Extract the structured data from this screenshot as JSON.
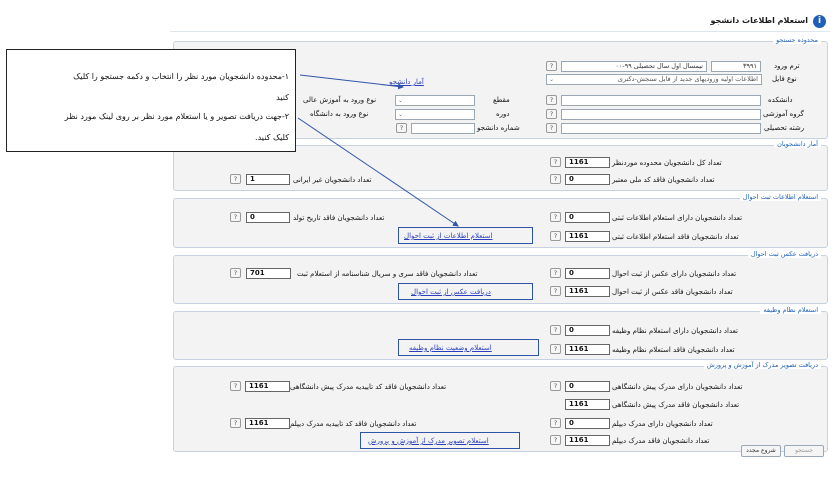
{
  "page": {
    "title": "استعلام اطلاعات دانشجو",
    "info_icon": "info-icon"
  },
  "search": {
    "legend": "محدوده جستجو",
    "term_label": "ترم ورود",
    "term_value": "۳۹۹۱",
    "term_desc": "نیمسال اول سال تحصیلی ۹۹-۰۰",
    "file_label": "نوع فایل",
    "file_value": "اطلاعات اولیه ورودیهای جدید از فایل سنجش-دکتری",
    "faculty_label": "دانشکده",
    "group_label": "گروه آموزشی",
    "field_label": "رشته تحصیلی",
    "level_label": "مقطع",
    "period_label": "دوره",
    "student_no_label": "شماره دانشجو",
    "entry_type_label": "نوع ورود به آموزش عالی",
    "entry_uni_label": "نوع ورود به دانشگاه",
    "students_link": "آمار دانشجو"
  },
  "stats": {
    "legend": "آمار دانشجویان",
    "total_label": "تعداد کل دانشجویان محدوده موردنظر",
    "total_value": "1161",
    "no_national_label": "تعداد دانشجویان فاقد کد ملی معتبر",
    "no_national_value": "0",
    "non_iranian_label": "تعداد دانشجویان غیر ایرانی",
    "non_iranian_value": "1"
  },
  "civil": {
    "legend": "استعلام اطلاعات ثبت احوال",
    "has_label": "تعداد دانشجویان دارای استعلام اطلاعات ثبتی",
    "has_value": "0",
    "lacks_label": "تعداد دانشجویان فاقد استعلام اطلاعات ثبتی",
    "lacks_value": "1161",
    "no_birth_label": "تعداد دانشجویان فاقد تاریخ تولد",
    "no_birth_value": "0",
    "link": "استعلام اطلاعات از ثبت احوال"
  },
  "photo": {
    "legend": "دریافت عکس ثبت احوال",
    "has_label": "تعداد دانشجویان دارای عکس از ثبت احوال",
    "has_value": "0",
    "lacks_label": "تعداد دانشجویان فاقد عکس از ثبت احوال",
    "lacks_value": "1161",
    "serial_label": "تعداد دانشجویان فاقد سری و سریال شناسنامه از استعلام ثبت",
    "serial_value": "701",
    "link": "دریافت عکس از ثبت احوال"
  },
  "military": {
    "legend": "استعلام نظام وظیفه",
    "has_label": "تعداد دانشجویان دارای استعلام نظام وظیفه",
    "has_value": "0",
    "lacks_label": "تعداد دانشجویان فاقد استعلام نظام وظیفه",
    "lacks_value": "1161",
    "link": "استعلام وضعیت نظام وظیفه"
  },
  "edu": {
    "legend": "دریافت تصویر مدرک از آموزش و پرورش",
    "has_pre_label": "تعداد دانشجویان دارای مدرک پیش دانشگاهی",
    "has_pre_value": "0",
    "lacks_pre_label": "تعداد دانشجویان فاقد مدرک پیش دانشگاهی",
    "lacks_pre_value": "1161",
    "has_dip_label": "تعداد دانشجویان دارای مدرک دیپلم",
    "has_dip_value": "0",
    "lacks_dip_label": "تعداد دانشجویان فاقد مدرک دیپلم",
    "lacks_dip_value": "1161",
    "confirm_pre_label": "تعداد دانشجویان فاقد کد تاییدیه مدرک پیش دانشگاهی",
    "confirm_pre_value": "1161",
    "confirm_dip_label": "تعداد دانشجویان فاقد کد تاییدیه مدرک دیپلم",
    "confirm_dip_value": "1161",
    "link": "استعلام تصویر مدرک از آموزش و پرورش"
  },
  "help_glyph": "?",
  "buttons": {
    "start": "شروع مجدد",
    "search": "جستجو"
  },
  "callout": {
    "line1": "۱-محدوده دانشجویان مورد نظر را انتخاب و دکمه جستجو را کلیک",
    "line2": "کنید",
    "line3": "۲-جهت  دریافت تصویر و یا استعلام مورد نظر بر روی لینک مورد نظر",
    "line4": "کلیک کنید."
  },
  "colors": {
    "link": "#2a3fbf",
    "legend": "#1f5fb8",
    "frame": "#2f55a8"
  }
}
